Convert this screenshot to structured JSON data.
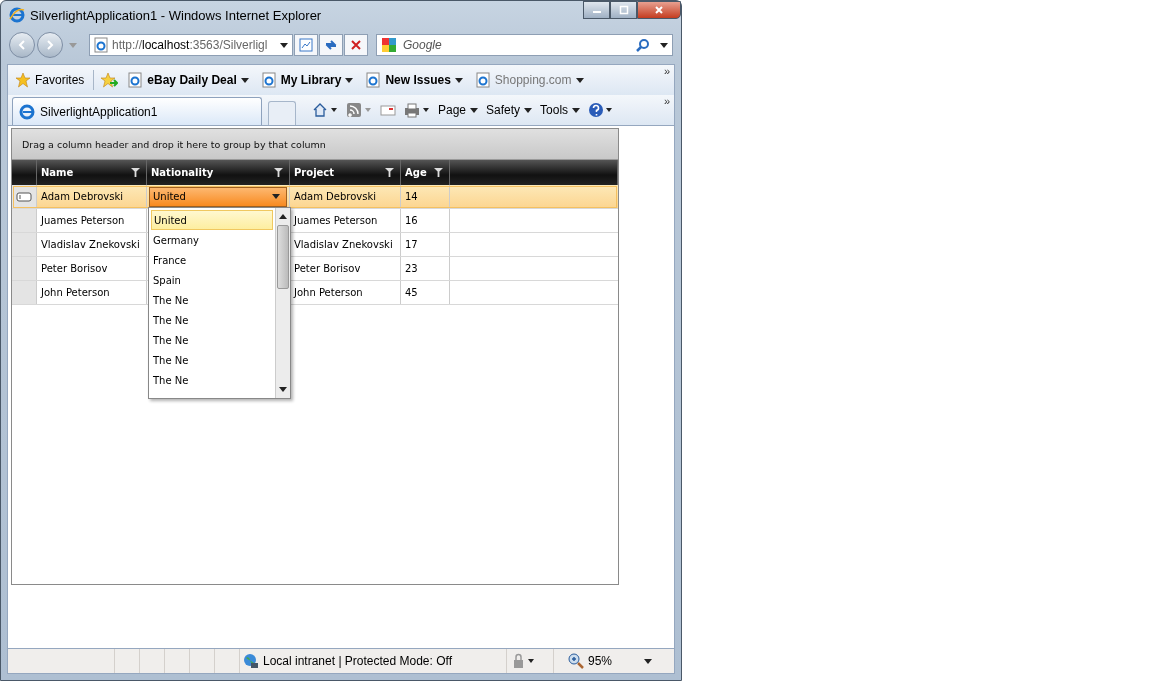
{
  "window": {
    "title": "SilverlightApplication1 - Windows Internet Explorer"
  },
  "address_bar": {
    "url_prefix": "http://",
    "url_host": "localhost",
    "url_rest": ":3563/Silverligl"
  },
  "search": {
    "placeholder": "Google"
  },
  "favorites_bar": {
    "favorites_label": "Favorites",
    "links": [
      {
        "label": "eBay Daily Deal",
        "emphasized": true
      },
      {
        "label": "My Library",
        "emphasized": true
      },
      {
        "label": "New Issues",
        "emphasized": true
      },
      {
        "label": "Shopping.com",
        "emphasized": false
      }
    ],
    "overflow": "»"
  },
  "tabs": [
    {
      "label": "SilverlightApplication1",
      "selected": true
    }
  ],
  "command_bar": {
    "menus": [
      "Page",
      "Safety",
      "Tools"
    ],
    "overflow": "»"
  },
  "grid": {
    "group_panel": "Drag a column header and drop it here to group by that column",
    "columns": [
      "Name",
      "Nationality",
      "Project",
      "Age"
    ],
    "rows": [
      {
        "name": "Adam Debrovski",
        "nationality": "United",
        "project": "Adam Debrovski",
        "age": "14",
        "selected": true
      },
      {
        "name": "Juames Peterson",
        "project": "Juames Peterson",
        "age": "16",
        "selected": false
      },
      {
        "name": "Vladislav Znekovski",
        "project": "Vladislav Znekovski",
        "age": "17",
        "selected": false
      },
      {
        "name": "Peter Borisov",
        "project": "Peter Borisov",
        "age": "23",
        "selected": false
      },
      {
        "name": "John Peterson",
        "project": "John Peterson",
        "age": "45",
        "selected": false
      }
    ],
    "dropdown": {
      "options": [
        {
          "label": "United",
          "selected": true
        },
        {
          "label": "Germany",
          "selected": false
        },
        {
          "label": "France",
          "selected": false
        },
        {
          "label": "Spain",
          "selected": false
        },
        {
          "label": "The Ne",
          "selected": false
        },
        {
          "label": "The Ne",
          "selected": false
        },
        {
          "label": "The Ne",
          "selected": false
        },
        {
          "label": "The Ne",
          "selected": false
        },
        {
          "label": "The Ne",
          "selected": false
        }
      ]
    }
  },
  "status_bar": {
    "zone": "Local intranet | Protected Mode: Off",
    "zoom": "95%"
  }
}
